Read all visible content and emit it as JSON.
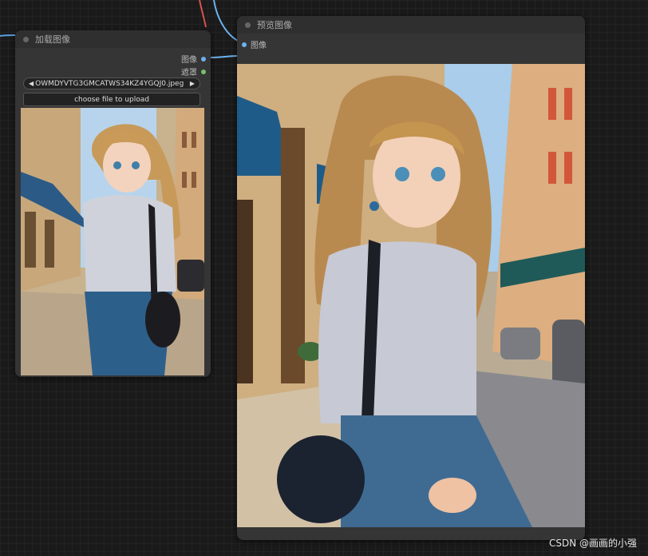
{
  "load_node": {
    "title": "加载图像",
    "outputs": {
      "image_label": "图像",
      "mask_label": "遮罩"
    },
    "file_widget": {
      "filename": "OWMDYVTG3GMCATWS34KZ4YGQJ0.jpeg",
      "prev_icon": "◀",
      "next_icon": "▶"
    },
    "upload_button_label": "choose file to upload",
    "thumbnail_icon": "anime-girl-street-image"
  },
  "preview_node": {
    "title": "预览图像",
    "input_label": "图像",
    "image_icon": "anime-girl-street-image"
  },
  "colors": {
    "image_socket": "#6cb2ee",
    "mask_socket": "#76c26a",
    "wire": "#6cb2ee",
    "wire_red": "#d9534f"
  },
  "watermark": "CSDN @画画的小强"
}
